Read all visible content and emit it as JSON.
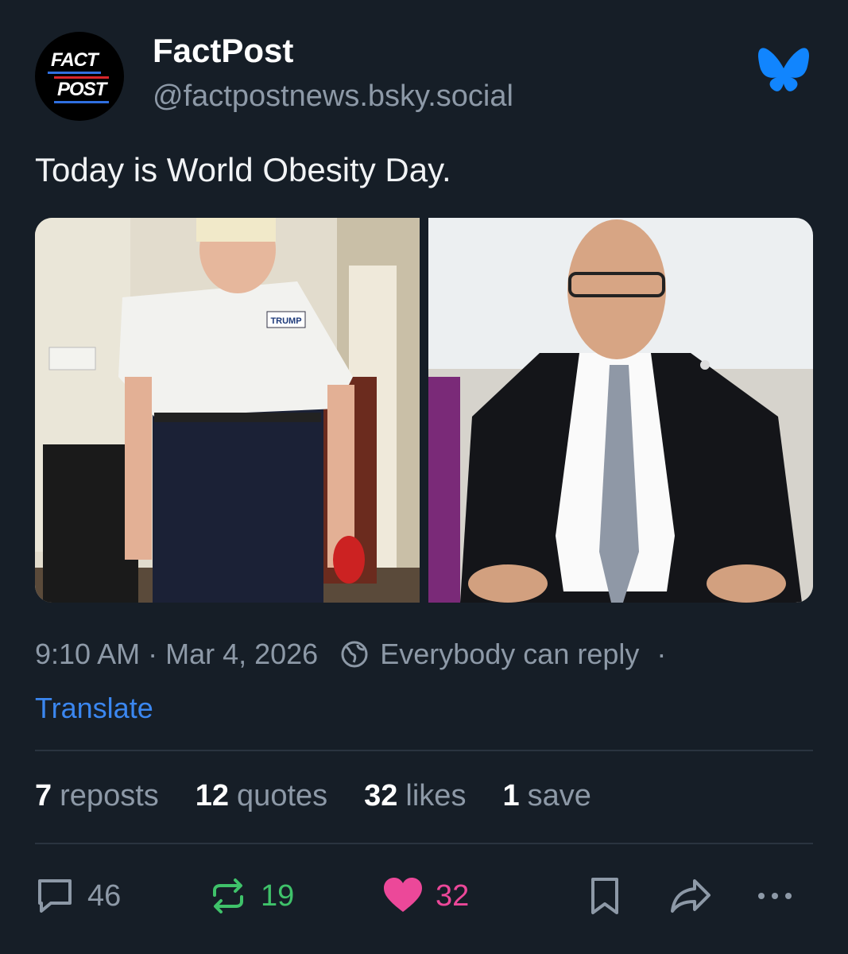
{
  "post": {
    "display_name": "FactPost",
    "handle": "@factpostnews.bsky.social",
    "avatar": {
      "line1": "FACT",
      "line2": "POST"
    },
    "text": "Today is World Obesity Day.",
    "images": [
      {
        "icon": "photo-left",
        "shirt_text": "TRUMP"
      },
      {
        "icon": "photo-right"
      }
    ],
    "time": "9:10 AM",
    "dot": "·",
    "date": "Mar 4, 2026",
    "reply_setting": "Everybody can reply",
    "translate_label": "Translate"
  },
  "stats": {
    "reposts_num": "7",
    "reposts_label": "reposts",
    "quotes_num": "12",
    "quotes_label": "quotes",
    "likes_num": "32",
    "likes_label": "likes",
    "saves_num": "1",
    "saves_label": "save"
  },
  "actions": {
    "reply_count": "46",
    "repost_count": "19",
    "like_count": "32"
  },
  "colors": {
    "background": "#161e27",
    "accent_blue": "#3b87f0",
    "repost_green": "#3fc26a",
    "like_pink": "#ec4899",
    "muted": "#8d99a7"
  }
}
